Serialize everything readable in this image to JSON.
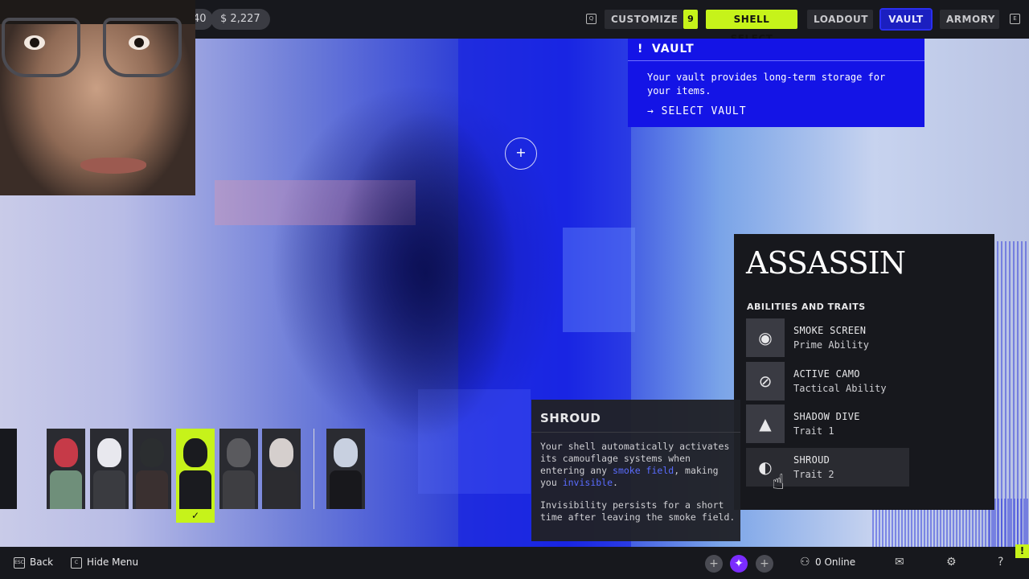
{
  "topbar": {
    "currency_partial": "40",
    "currency": "2,227",
    "currency_icon": "coin-icon",
    "left_key": "Q",
    "right_key": "E",
    "tabs": [
      {
        "label": "CUSTOMIZE",
        "badge": "9"
      },
      {
        "label": "SHELL SELECT"
      },
      {
        "label": "LOADOUT"
      },
      {
        "label": "VAULT"
      },
      {
        "label": "ARMORY"
      }
    ],
    "active_tab": "SHELL SELECT",
    "hovered_tab": "VAULT"
  },
  "vault_popup": {
    "title": "VAULT",
    "icon": "!",
    "description": "Your vault provides long-term storage for your items.",
    "action": "→ SELECT VAULT"
  },
  "shell_class": {
    "name": "ASSASSIN",
    "section_label": "ABILITIES AND TRAITS",
    "abilities": [
      {
        "name": "SMOKE SCREEN",
        "type": "Prime Ability",
        "icon": "smoke-screen-icon",
        "glyph": "◉"
      },
      {
        "name": "ACTIVE CAMO",
        "type": "Tactical Ability",
        "icon": "active-camo-icon",
        "glyph": "⊘"
      },
      {
        "name": "SHADOW DIVE",
        "type": "Trait 1",
        "icon": "shadow-dive-icon",
        "glyph": "▲"
      },
      {
        "name": "SHROUD",
        "type": "Trait 2",
        "icon": "shroud-icon",
        "glyph": "◐"
      }
    ],
    "selected_ability": "SHROUD"
  },
  "tooltip": {
    "title": "SHROUD",
    "p1_a": "Your shell automatically activates its camouflage systems when entering any ",
    "p1_hl1": "smoke field",
    "p1_b": ", making you ",
    "p1_hl2": "invisible",
    "p1_c": ".",
    "p2": "Invisibility persists for a short time after leaving the smoke field."
  },
  "roster": {
    "selected_index": 3,
    "check": "✓",
    "shells": [
      {
        "head": "#c63a48",
        "body": "#6f8f7a"
      },
      {
        "head": "#e8e8ee",
        "body": "#3a3b40"
      },
      {
        "head": "#2b2e30",
        "body": "#3a3030"
      },
      {
        "head": "#1a1b1f",
        "body": "#1a1b1f"
      },
      {
        "head": "#5a5a5e",
        "body": "#3e3e42"
      },
      {
        "head": "#d5cfcd",
        "body": "#2c2c30"
      },
      {
        "head": "#c8d0e0",
        "body": "#18181c"
      }
    ]
  },
  "bottombar": {
    "back_key": "ESC",
    "back_label": "Back",
    "hide_key": "C",
    "hide_label": "Hide Menu",
    "squad_add": "+",
    "online": "0 Online",
    "help": "?",
    "notification": "!"
  },
  "colors": {
    "accent": "#c6f31a",
    "vault_blue": "#1414e6",
    "panel": "#17181d"
  }
}
